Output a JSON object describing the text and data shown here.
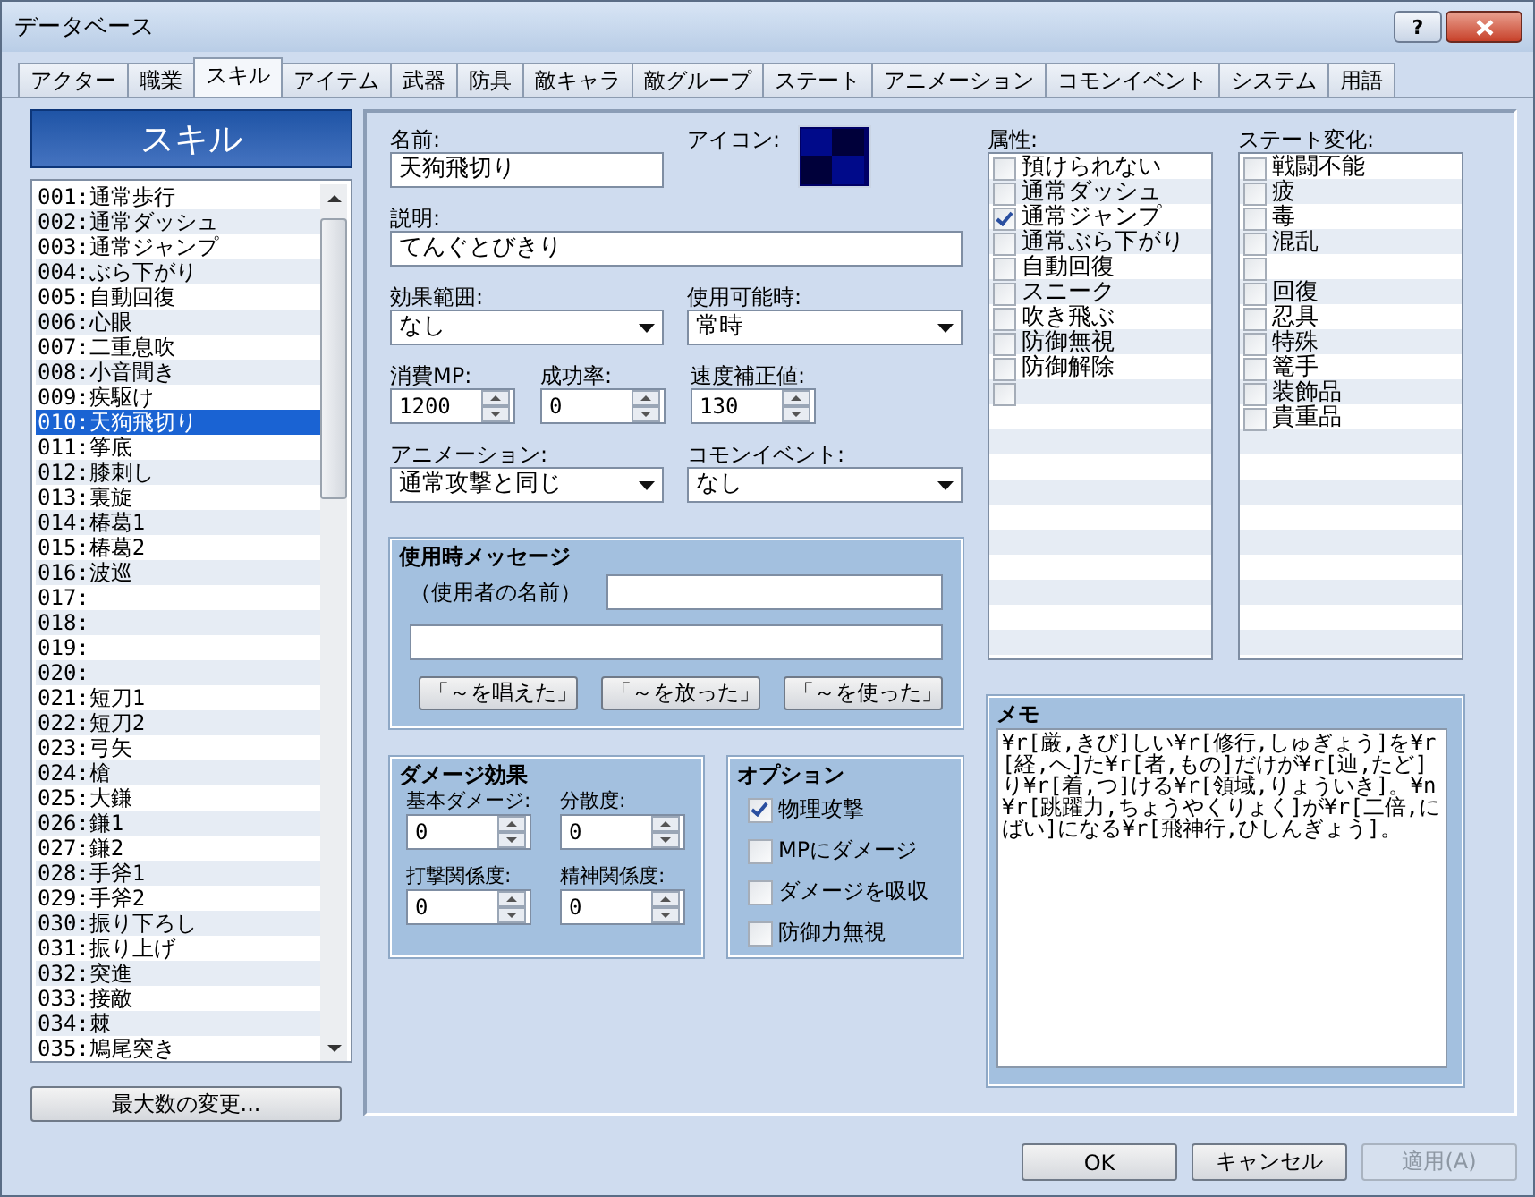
{
  "window": {
    "title": "データベース",
    "help_button": "?"
  },
  "tabs": [
    {
      "label": "アクター",
      "selected": false
    },
    {
      "label": "職業",
      "selected": false
    },
    {
      "label": "スキル",
      "selected": true
    },
    {
      "label": "アイテム",
      "selected": false
    },
    {
      "label": "武器",
      "selected": false
    },
    {
      "label": "防具",
      "selected": false
    },
    {
      "label": "敵キャラ",
      "selected": false
    },
    {
      "label": "敵グループ",
      "selected": false
    },
    {
      "label": "ステート",
      "selected": false
    },
    {
      "label": "アニメーション",
      "selected": false
    },
    {
      "label": "コモンイベント",
      "selected": false
    },
    {
      "label": "システム",
      "selected": false
    },
    {
      "label": "用語",
      "selected": false
    }
  ],
  "skill_list": {
    "title": "スキル",
    "items": [
      {
        "label": "001:通常歩行",
        "selected": false
      },
      {
        "label": "002:通常ダッシュ",
        "selected": false
      },
      {
        "label": "003:通常ジャンプ",
        "selected": false
      },
      {
        "label": "004:ぶら下がり",
        "selected": false
      },
      {
        "label": "005:自動回復",
        "selected": false
      },
      {
        "label": "006:心眼",
        "selected": false
      },
      {
        "label": "007:二重息吹",
        "selected": false
      },
      {
        "label": "008:小音聞き",
        "selected": false
      },
      {
        "label": "009:疾駆け",
        "selected": false
      },
      {
        "label": "010:天狗飛切り",
        "selected": true
      },
      {
        "label": "011:筝底",
        "selected": false
      },
      {
        "label": "012:膝刺し",
        "selected": false
      },
      {
        "label": "013:裏旋",
        "selected": false
      },
      {
        "label": "014:椿葛1",
        "selected": false
      },
      {
        "label": "015:椿葛2",
        "selected": false
      },
      {
        "label": "016:波巡",
        "selected": false
      },
      {
        "label": "017:",
        "selected": false
      },
      {
        "label": "018:",
        "selected": false
      },
      {
        "label": "019:",
        "selected": false
      },
      {
        "label": "020:",
        "selected": false
      },
      {
        "label": "021:短刀1",
        "selected": false
      },
      {
        "label": "022:短刀2",
        "selected": false
      },
      {
        "label": "023:弓矢",
        "selected": false
      },
      {
        "label": "024:槍",
        "selected": false
      },
      {
        "label": "025:大鎌",
        "selected": false
      },
      {
        "label": "026:鎌1",
        "selected": false
      },
      {
        "label": "027:鎌2",
        "selected": false
      },
      {
        "label": "028:手斧1",
        "selected": false
      },
      {
        "label": "029:手斧2",
        "selected": false
      },
      {
        "label": "030:振り下ろし",
        "selected": false
      },
      {
        "label": "031:振り上げ",
        "selected": false
      },
      {
        "label": "032:突進",
        "selected": false
      },
      {
        "label": "033:接敵",
        "selected": false
      },
      {
        "label": "034:棘",
        "selected": false
      },
      {
        "label": "035:鳩尾突き",
        "selected": false
      }
    ],
    "max_button": "最大数の変更..."
  },
  "form": {
    "name": {
      "label": "名前:",
      "value": "天狗飛切り"
    },
    "icon": {
      "label": "アイコン:"
    },
    "description": {
      "label": "説明:",
      "value": "てんぐとびきり"
    },
    "scope": {
      "label": "効果範囲:",
      "value": "なし"
    },
    "occasion": {
      "label": "使用可能時:",
      "value": "常時"
    },
    "mp_cost": {
      "label": "消費MP:",
      "value": "1200"
    },
    "hit_rate": {
      "label": "成功率:",
      "value": "0"
    },
    "speed": {
      "label": "速度補正値:",
      "value": "130"
    },
    "animation": {
      "label": "アニメーション:",
      "value": "通常攻撃と同じ"
    },
    "common_event": {
      "label": "コモンイベント:",
      "value": "なし"
    }
  },
  "message": {
    "title": "使用時メッセージ",
    "user_label": "（使用者の名前）",
    "buttons": [
      "「～を唱えた」",
      "「～を放った」",
      "「～を使った」"
    ]
  },
  "damage": {
    "title": "ダメージ効果",
    "fields": [
      {
        "label": "基本ダメージ:",
        "value": "0"
      },
      {
        "label": "分散度:",
        "value": "0"
      },
      {
        "label": "打撃関係度:",
        "value": "0"
      },
      {
        "label": "精神関係度:",
        "value": "0"
      }
    ]
  },
  "options": {
    "title": "オプション",
    "items": [
      {
        "label": "物理攻撃",
        "checked": true
      },
      {
        "label": "MPにダメージ",
        "checked": false
      },
      {
        "label": "ダメージを吸収",
        "checked": false
      },
      {
        "label": "防御力無視",
        "checked": false
      }
    ]
  },
  "elements": {
    "label": "属性:",
    "items": [
      {
        "label": "預けられない",
        "checked": false
      },
      {
        "label": "通常ダッシュ",
        "checked": false
      },
      {
        "label": "通常ジャンプ",
        "checked": true
      },
      {
        "label": "通常ぶら下がり",
        "checked": false
      },
      {
        "label": "自動回復",
        "checked": false
      },
      {
        "label": "スニーク",
        "checked": false
      },
      {
        "label": "吹き飛ぶ",
        "checked": false
      },
      {
        "label": "防御無視",
        "checked": false
      },
      {
        "label": "防御解除",
        "checked": false
      },
      {
        "checked": false
      }
    ]
  },
  "states": {
    "label": "ステート変化:",
    "items": [
      {
        "label": "戦闘不能",
        "checked": false
      },
      {
        "label": "疲",
        "checked": false
      },
      {
        "label": "毒",
        "checked": false
      },
      {
        "label": "混乱",
        "checked": false
      },
      {
        "checked": false
      },
      {
        "label": "回復",
        "checked": false
      },
      {
        "label": "忍具",
        "checked": false
      },
      {
        "label": "特殊",
        "checked": false
      },
      {
        "label": "篭手",
        "checked": false
      },
      {
        "label": "装飾品",
        "checked": false
      },
      {
        "label": "貴重品",
        "checked": false
      }
    ]
  },
  "memo": {
    "title": "メモ",
    "text": "¥r[厳,きび]しい¥r[修行,しゅぎょう]を¥r[経,へ]た¥r[者,もの]だけが¥r[辿,たど]り¥r[着,つ]ける¥r[領域,りょういき]。¥n¥r[跳躍力,ちょうやくりょく]が¥r[二倍,にばい]になる¥r[飛神行,ひしんぎょう]。"
  },
  "buttons": [
    {
      "label": "OK",
      "disabled": false
    },
    {
      "label": "キャンセル",
      "disabled": false
    },
    {
      "label": "適用(A)",
      "disabled": true
    }
  ]
}
